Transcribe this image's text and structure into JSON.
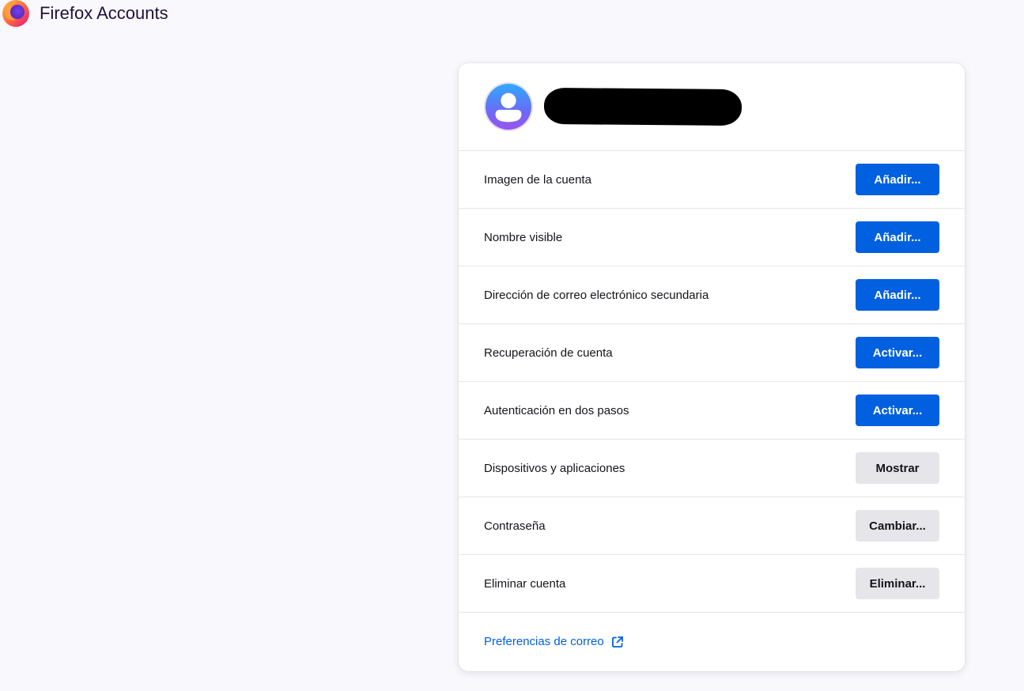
{
  "app": {
    "title": "Firefox Accounts"
  },
  "settings": {
    "rows": [
      {
        "label": "Imagen de la cuenta",
        "button": "Añadir...",
        "style": "primary"
      },
      {
        "label": "Nombre visible",
        "button": "Añadir...",
        "style": "primary"
      },
      {
        "label": "Dirección de correo electrónico secundaria",
        "button": "Añadir...",
        "style": "primary"
      },
      {
        "label": "Recuperación de cuenta",
        "button": "Activar...",
        "style": "primary"
      },
      {
        "label": "Autenticación en dos pasos",
        "button": "Activar...",
        "style": "primary"
      },
      {
        "label": "Dispositivos y aplicaciones",
        "button": "Mostrar",
        "style": "secondary"
      },
      {
        "label": "Contraseña",
        "button": "Cambiar...",
        "style": "secondary"
      },
      {
        "label": "Eliminar cuenta",
        "button": "Eliminar...",
        "style": "secondary"
      }
    ],
    "footer_link": "Preferencias de correo"
  },
  "icons": {
    "logo": "firefox-logo-icon",
    "avatar": "default-avatar-icon",
    "external": "external-link-icon"
  },
  "colors": {
    "primary": "#0060df",
    "secondary": "#e5e5ea",
    "background": "#f9f9fd"
  }
}
